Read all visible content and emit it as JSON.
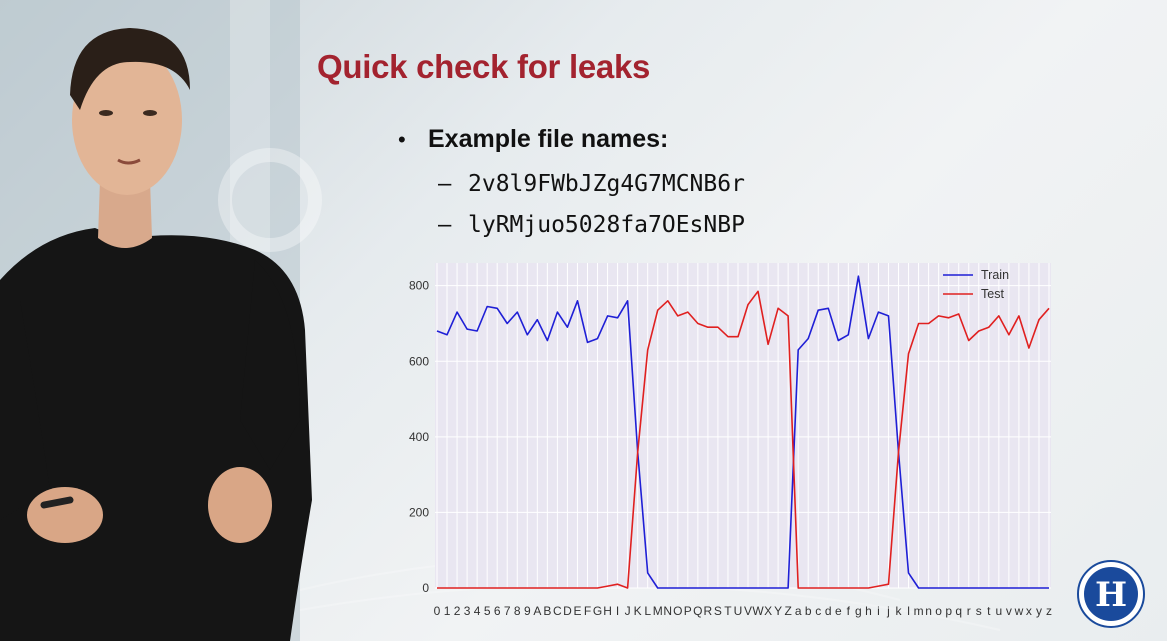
{
  "slide": {
    "title": "Quick check for leaks",
    "bullet": "Example file names:",
    "file_names": [
      "2v8l9FWbJZg4G7MCNB6r",
      "lyRMjuo5028fa7OEsNBP"
    ]
  },
  "colors": {
    "title": "#a3232f",
    "train": "#1f1fd6",
    "test": "#e02020",
    "plot_bg": "#e9e6f1",
    "logo": "#1a4a9c"
  },
  "icons": {
    "logo": "hse-university-logo",
    "presenter": "presenter-person"
  },
  "chart_data": {
    "type": "line",
    "categories": [
      "0",
      "1",
      "2",
      "3",
      "4",
      "5",
      "6",
      "7",
      "8",
      "9",
      "A",
      "B",
      "C",
      "D",
      "E",
      "F",
      "G",
      "H",
      "I",
      "J",
      "K",
      "L",
      "M",
      "N",
      "O",
      "P",
      "Q",
      "R",
      "S",
      "T",
      "U",
      "V",
      "W",
      "X",
      "Y",
      "Z",
      "a",
      "b",
      "c",
      "d",
      "e",
      "f",
      "g",
      "h",
      "i",
      "j",
      "k",
      "l",
      "m",
      "n",
      "o",
      "p",
      "q",
      "r",
      "s",
      "t",
      "u",
      "v",
      "w",
      "x",
      "y",
      "z"
    ],
    "series": [
      {
        "name": "Train",
        "values": [
          680,
          670,
          730,
          685,
          680,
          745,
          740,
          700,
          730,
          670,
          710,
          655,
          730,
          690,
          760,
          650,
          660,
          720,
          715,
          760,
          360,
          40,
          0,
          0,
          0,
          0,
          0,
          0,
          0,
          0,
          0,
          0,
          0,
          0,
          0,
          0,
          630,
          660,
          735,
          740,
          655,
          670,
          825,
          660,
          730,
          720,
          360,
          40,
          0,
          0,
          0,
          0,
          0,
          0,
          0,
          0,
          0,
          0,
          0,
          0,
          0,
          0
        ]
      },
      {
        "name": "Test",
        "values": [
          0,
          0,
          0,
          0,
          0,
          0,
          0,
          0,
          0,
          0,
          0,
          0,
          0,
          0,
          0,
          0,
          0,
          5,
          10,
          0,
          360,
          630,
          735,
          760,
          720,
          730,
          700,
          690,
          690,
          665,
          665,
          750,
          785,
          645,
          740,
          720,
          0,
          0,
          0,
          0,
          0,
          0,
          0,
          0,
          5,
          10,
          360,
          620,
          700,
          700,
          720,
          715,
          725,
          655,
          680,
          690,
          720,
          670,
          720,
          635,
          710,
          740
        ]
      }
    ],
    "ylim": [
      0,
      860
    ],
    "yticks": [
      0,
      200,
      400,
      600,
      800
    ],
    "grid": true,
    "legend": "top-right"
  }
}
